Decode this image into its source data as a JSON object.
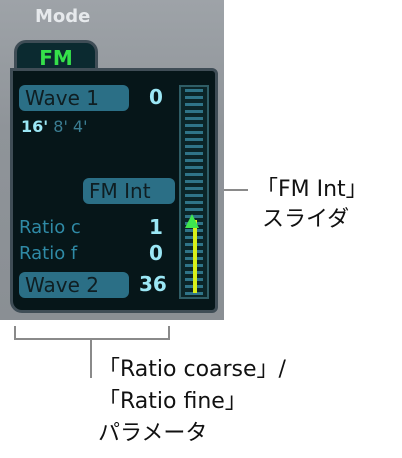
{
  "panel": {
    "mode_label": "Mode",
    "fm_tab_label": "FM",
    "wave1": {
      "label": "Wave 1",
      "value": "0"
    },
    "octave": {
      "active": "16'",
      "others": "8' 4'"
    },
    "fm_int_label": "FM Int",
    "ratio_coarse": {
      "label": "Ratio c",
      "value": "1"
    },
    "ratio_fine": {
      "label": "Ratio f",
      "value": "0"
    },
    "wave2": {
      "label": "Wave 2",
      "value": "36"
    },
    "fm_int_level": 0.36,
    "colors": {
      "panel": "#9ea3a8",
      "screen": "#061619",
      "accent_green": "#35e04a",
      "value_cyan": "#9be7f5",
      "label_blue": "#2f8aa6",
      "fill_yellow": "#d8f01a"
    }
  },
  "annotations": {
    "fm_int_slider": [
      "「FM Int」",
      "スライダ"
    ],
    "ratio_params": [
      "「Ratio coarse」/",
      "「Ratio fine」",
      "パラメータ"
    ]
  }
}
